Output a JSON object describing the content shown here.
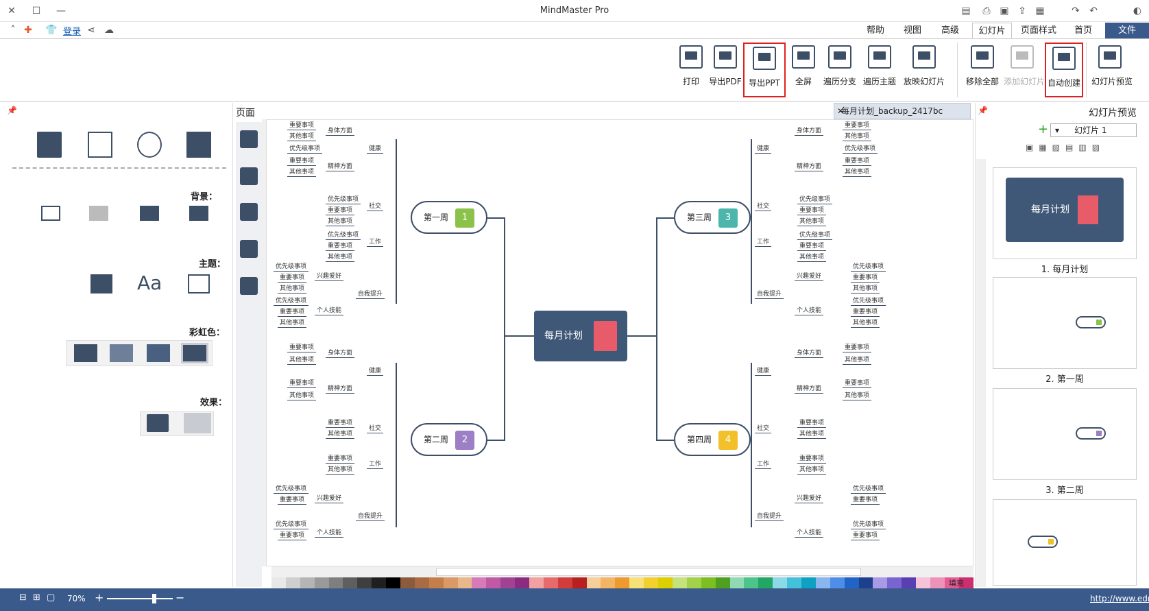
{
  "window": {
    "title": "MindMaster Pro"
  },
  "quick_access": {
    "login_label": "登录"
  },
  "menu": {
    "tabs": [
      {
        "label": "文件"
      },
      {
        "label": "首页"
      },
      {
        "label": "页面样式"
      },
      {
        "label": "幻灯片"
      },
      {
        "label": "高级"
      },
      {
        "label": "视图"
      },
      {
        "label": "帮助"
      }
    ]
  },
  "ribbon": {
    "buttons": [
      {
        "label": "幻灯片预览",
        "icon": "slide-preview-icon"
      },
      {
        "label": "自动创建",
        "icon": "auto-create-icon"
      },
      {
        "label": "添加幻灯片",
        "icon": "add-slide-icon"
      },
      {
        "label": "移除全部",
        "icon": "remove-all-icon"
      },
      {
        "label": "放映幻灯片",
        "icon": "slideshow-icon"
      },
      {
        "label": "遍历主题",
        "icon": "traverse-topic-icon"
      },
      {
        "label": "遍历分支",
        "icon": "traverse-branch-icon"
      },
      {
        "label": "全屏",
        "icon": "fullscreen-icon"
      },
      {
        "label": "导出PPT",
        "icon": "export-ppt-icon"
      },
      {
        "label": "导出PDF",
        "icon": "export-pdf-icon"
      },
      {
        "label": "打印",
        "icon": "print-icon"
      }
    ]
  },
  "left_panel": {
    "background_label": "背景：",
    "theme_label": "主题：",
    "rainbow_label": "彩虹色：",
    "effect_label": "效果：",
    "page_label": "页面"
  },
  "canvas": {
    "tab_title": "每月计划_backup_2417bc",
    "central_topic": "每月计划",
    "weeks": [
      {
        "label": "第一周",
        "number": "1",
        "color": "#8bc34a"
      },
      {
        "label": "第二周",
        "number": "2",
        "color": "#9c7fc4"
      },
      {
        "label": "第三周",
        "number": "3",
        "color": "#4db6ac"
      },
      {
        "label": "第四周",
        "number": "4",
        "color": "#f2c02b"
      }
    ],
    "categories": [
      "健康",
      "社交",
      "工作",
      "自我提升"
    ],
    "subtopics": [
      "身体方面",
      "精神方面",
      "兴趣爱好",
      "个人技能"
    ],
    "leaves": [
      "重要事项",
      "其他事项",
      "优先级事项"
    ]
  },
  "slide_panel": {
    "title": "幻灯片预览",
    "selector_value": "幻灯片 1",
    "slides": [
      {
        "label": "1. 每月计划",
        "title": "每月计划"
      },
      {
        "label": "2. 第一周"
      },
      {
        "label": "3. 第二周"
      },
      {
        "label": ""
      }
    ]
  },
  "status": {
    "url": "http://www.edrawsoft.cn",
    "zoom": "70%",
    "fill_label": "填充"
  },
  "colors": {
    "accent": "#3a5a8c",
    "node_dark": "#3f5877",
    "highlight": "#e02020"
  }
}
